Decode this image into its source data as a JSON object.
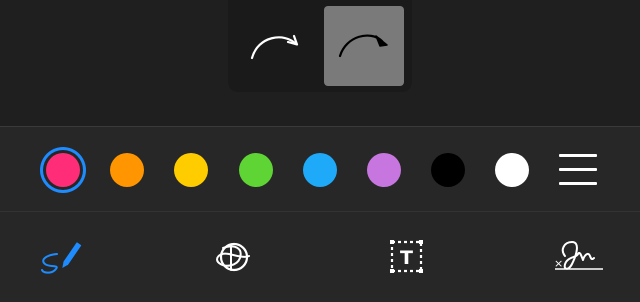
{
  "arrow_styles": [
    {
      "name": "open-arrow",
      "selected": false
    },
    {
      "name": "filled-arrow",
      "selected": true
    }
  ],
  "palette": {
    "colors": [
      {
        "name": "pink",
        "hex": "#ff2d78",
        "selected": true
      },
      {
        "name": "orange",
        "hex": "#ff9500",
        "selected": false
      },
      {
        "name": "yellow",
        "hex": "#ffcc00",
        "selected": false
      },
      {
        "name": "green",
        "hex": "#5ed534",
        "selected": false
      },
      {
        "name": "blue",
        "hex": "#1eaaf9",
        "selected": false
      },
      {
        "name": "purple",
        "hex": "#c776e0",
        "selected": false
      },
      {
        "name": "black",
        "hex": "#000000",
        "selected": false
      },
      {
        "name": "white",
        "hex": "#ffffff",
        "selected": false
      }
    ],
    "more_icon": "hamburger-menu-icon",
    "selection_ring_color": "#1e8bff"
  },
  "tools": {
    "sketch": {
      "icon": "sketch-pen-icon",
      "color": "#1e8bff"
    },
    "shape": {
      "icon": "shape-recognition-icon",
      "color": "#ffffff"
    },
    "text": {
      "icon": "text-box-icon",
      "letter": "T",
      "color": "#ffffff"
    },
    "signature": {
      "icon": "signature-icon",
      "mark": "×",
      "color": "#ffffff"
    }
  }
}
